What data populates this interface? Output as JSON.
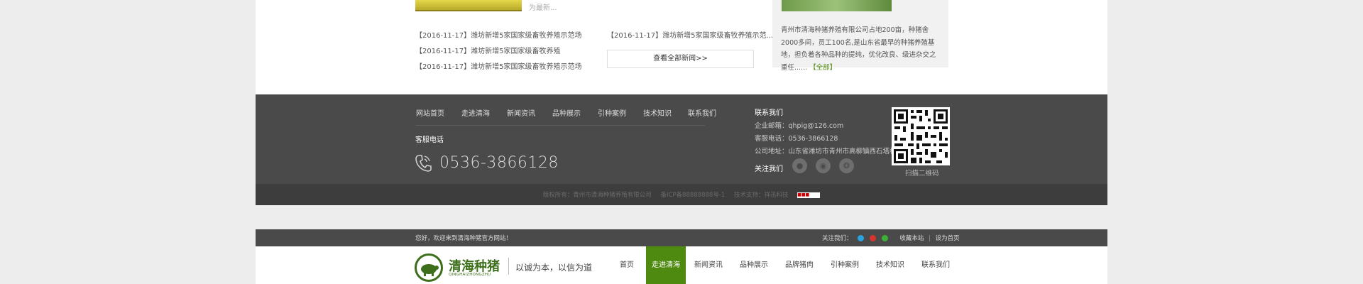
{
  "news": {
    "more_text": "为最新...",
    "left_items": [
      "【2016-11-17】潍坊新增5家国家级畜牧养殖示范场",
      "【2016-11-17】潍坊新增5家国家级畜牧养殖",
      "【2016-11-17】潍坊新增5家国家级畜牧养殖示范场"
    ],
    "right_items": [
      "【2016-11-17】潍坊新增5家国家级畜牧养殖示范..."
    ],
    "all_news_label": "查看全部新闻>>"
  },
  "intro": {
    "text": "青州市清海种猪养殖有限公司占地200亩，种猪舍2000多间，员工100名,是山东省最早的种猪养殖基地，担负着各种品种的提纯，优化改良、级进杂交之重任......",
    "more_label": "【全部】"
  },
  "footer": {
    "nav": [
      "网站首页",
      "走进清海",
      "新闻资讯",
      "品种展示",
      "引种案例",
      "技术知识",
      "联系我们"
    ],
    "service_label": "客服电话",
    "phone": "0536-3866128",
    "contact_title": "联系我们",
    "email": "企业邮箱：qhpig@126.com",
    "tel": "客服电话：0536-3866128",
    "address": "公司地址：山东省潍坊市青州市高柳镇西石塔村",
    "follow_label": "关注我们",
    "qr_label": "扫描二维码"
  },
  "copyright": {
    "owner": "版权所有：青州市清海种猪养殖有限公司",
    "icp": "备ICP备88888888号-1",
    "support": "技术支持：祥迅科技"
  },
  "topbar": {
    "welcome": "您好，欢迎来到清海种猪官方网站！",
    "follow": "关注我们：",
    "bookmark": "收藏本站",
    "homepage": "设为首页"
  },
  "header": {
    "logo_cn": "清海种猪",
    "logo_pinyin": "QINGHAIZHONGZHU",
    "slogan": "以诚为本，以信为道",
    "nav": [
      "首页",
      "走进清海",
      "新闻资讯",
      "品种展示",
      "品牌猪肉",
      "引种案例",
      "技术知识",
      "联系我们"
    ],
    "active_index": 1
  },
  "colors": {
    "brand_green": "#4f8a10",
    "footer_bg": "#4a4a4a"
  }
}
